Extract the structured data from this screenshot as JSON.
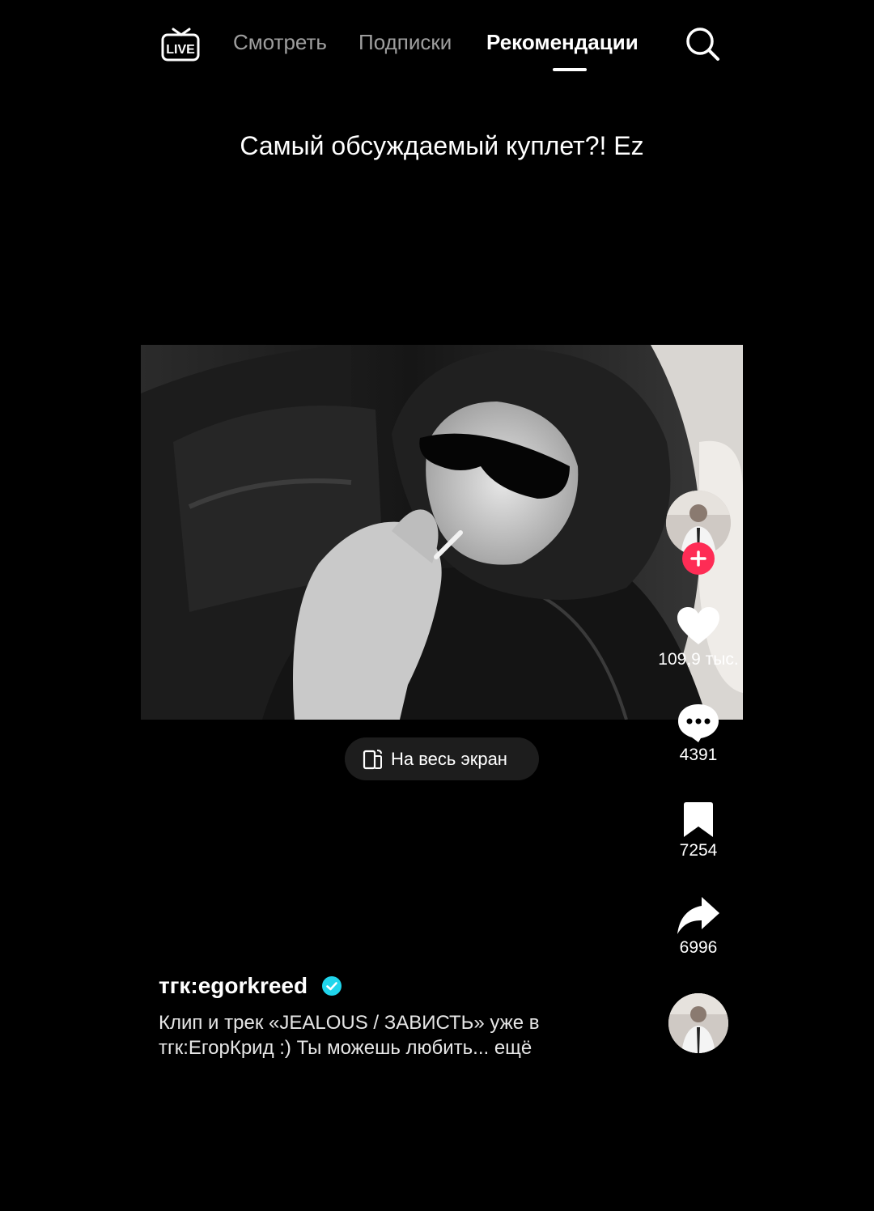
{
  "nav": {
    "live_icon": "live-tv-icon",
    "tabs": [
      {
        "label": "Смотреть",
        "active": false
      },
      {
        "label": "Подписки",
        "active": false
      },
      {
        "label": "Рекомендации",
        "active": true
      }
    ],
    "search_icon": "search-icon"
  },
  "video": {
    "caption": "Самый обсуждаемый куплет?! Ez",
    "fullscreen_label": "На весь экран"
  },
  "actions": {
    "likes": "109,9 тыс.",
    "comments": "4391",
    "saves": "7254",
    "shares": "6996"
  },
  "post": {
    "author": "тгк:egorkreed",
    "description_line1": "Клип и трек «JEALOUS / ЗАВИСТЬ» уже в",
    "description_line2": "тгк:ЕгорКрид :) Ты можешь любить... ещё"
  },
  "colors": {
    "accent": "#fe2c55",
    "verified": "#20d5ec",
    "background": "#000000"
  }
}
